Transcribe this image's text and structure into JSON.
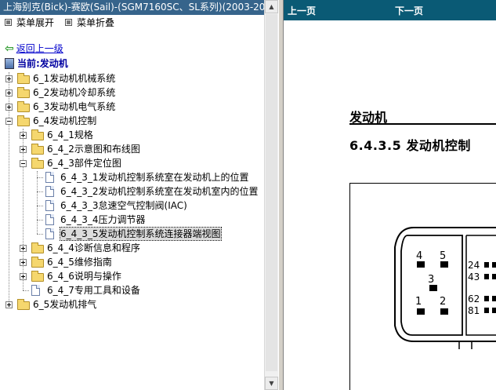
{
  "window_title": "上海别克(Bick)-赛欧(Sail)-(SGM7160SC、SL系列)(2003-20",
  "menu": {
    "expand": "菜单展开",
    "collapse": "菜单折叠"
  },
  "back_link": "返回上一级",
  "current": "当前:发动机",
  "tree": {
    "n1": "6_1发动机机械系统",
    "n2": "6_2发动机冷却系统",
    "n3": "6_3发动机电气系统",
    "n4": "6_4发动机控制",
    "n4_1": "6_4_1规格",
    "n4_2": "6_4_2示意图和布线图",
    "n4_3": "6_4_3部件定位图",
    "n4_3_1": "6_4_3_1发动机控制系统室在发动机上的位置",
    "n4_3_2": "6_4_3_2发动机控制系统室在发动机室内的位置",
    "n4_3_3": "6_4_3_3怠速空气控制阀(IAC)",
    "n4_3_4": "6_4_3_4压力调节器",
    "n4_3_5": "6_4_3_5发动机控制系统连接器端视图",
    "n4_4": "6_4_4诊断信息和程序",
    "n4_5": "6_4_5维修指南",
    "n4_6": "6_4_6说明与操作",
    "n4_7": "6_4_7专用工具和设备",
    "n5": "6_5发动机排气"
  },
  "nav": {
    "prev": "上一页",
    "next": "下一页"
  },
  "content": {
    "section_title": "发动机",
    "subtitle": "6.4.3.5 发动机控制",
    "pins": {
      "p4": "4",
      "p5": "5",
      "p3": "3",
      "p1": "1",
      "p2": "2",
      "p24": "24",
      "p43": "43",
      "p62": "62",
      "p81": "81"
    }
  },
  "colors": {
    "titlebar": "#36648b",
    "navbar": "#0a5a75",
    "link": "#0000cc",
    "current": "#0000a0"
  }
}
